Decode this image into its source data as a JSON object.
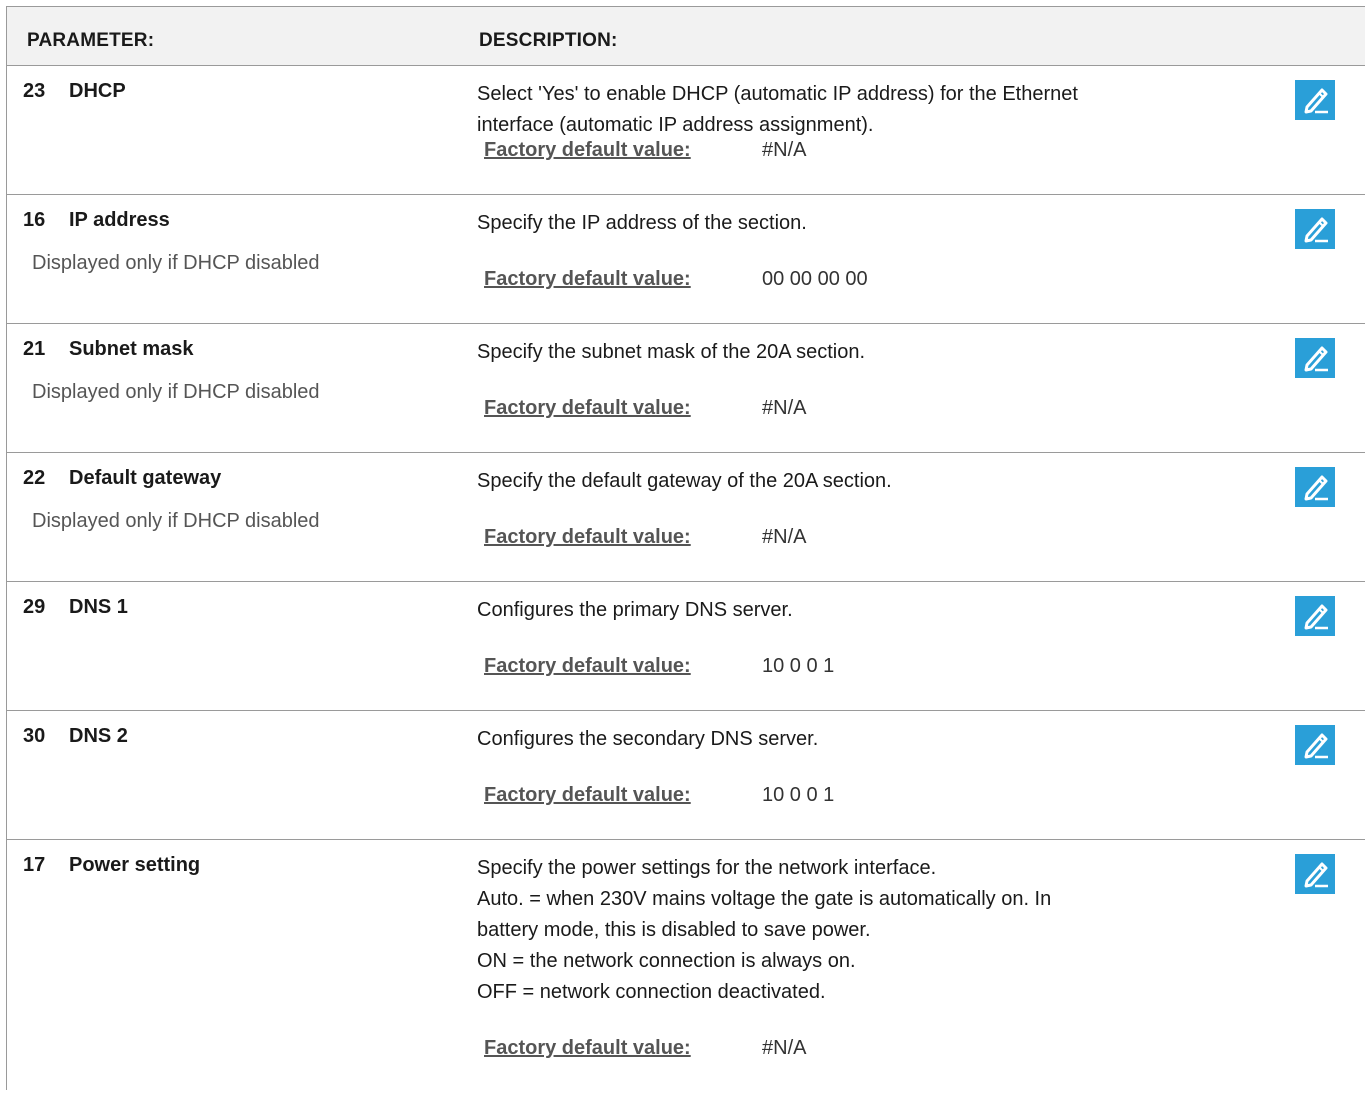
{
  "header": {
    "parameter": "PARAMETER:",
    "description": "DESCRIPTION:"
  },
  "default_label": "Factory default value:",
  "icon": "edit-pencil-icon",
  "accent_color": "#2a9fd8",
  "rows": [
    {
      "num": "23",
      "name": "DHCP",
      "condition": "",
      "description": "Select 'Yes' to enable DHCP (automatic IP address) for the Ethernet\ninterface (automatic IP address assignment).",
      "default": "#N/A"
    },
    {
      "num": "16",
      "name": "IP address",
      "condition": "Displayed only if DHCP disabled",
      "description": "Specify the IP address of the section.",
      "default": "00 00 00 00"
    },
    {
      "num": "21",
      "name": "Subnet mask",
      "condition": "Displayed only if DHCP disabled",
      "description": "Specify the subnet mask of the 20A section.",
      "default": "#N/A"
    },
    {
      "num": "22",
      "name": "Default gateway",
      "condition": "Displayed only if DHCP disabled",
      "description": "Specify the default gateway of the 20A section.",
      "default": "#N/A"
    },
    {
      "num": "29",
      "name": "DNS 1",
      "condition": "",
      "description": "Configures the primary DNS server.",
      "default": "10 0 0 1"
    },
    {
      "num": "30",
      "name": "DNS 2",
      "condition": "",
      "description": "Configures the secondary DNS server.",
      "default": "10 0 0 1"
    },
    {
      "num": "17",
      "name": "Power setting",
      "condition": "",
      "description": "Specify the power settings for the network interface.\nAuto. = when 230V mains voltage the gate is automatically on. In\nbattery mode, this is disabled to save power.\nON = the network connection is always on.\nOFF = network connection deactivated.",
      "default": "#N/A"
    }
  ]
}
